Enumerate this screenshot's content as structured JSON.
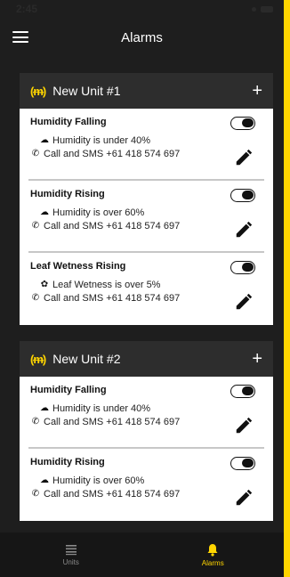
{
  "status": {
    "time": "2:45"
  },
  "nav": {
    "title": "Alarms"
  },
  "units": [
    {
      "name": "New Unit #1",
      "alarms": [
        {
          "title": "Humidity Falling",
          "condition_icon": "cloud-icon",
          "condition": "Humidity is under 40%",
          "action": "Call and SMS +61 418 574 697",
          "enabled": false
        },
        {
          "title": "Humidity Rising",
          "condition_icon": "cloud-icon",
          "condition": "Humidity is over 60%",
          "action": "Call and SMS +61 418 574 697",
          "enabled": false
        },
        {
          "title": "Leaf Wetness Rising",
          "condition_icon": "leaf-icon",
          "condition": "Leaf Wetness is over 5%",
          "action": "Call and SMS +61 418 574 697",
          "enabled": false
        }
      ]
    },
    {
      "name": "New Unit #2",
      "alarms": [
        {
          "title": "Humidity Falling",
          "condition_icon": "cloud-icon",
          "condition": "Humidity is under 40%",
          "action": "Call and SMS +61 418 574 697",
          "enabled": false
        },
        {
          "title": "Humidity Rising",
          "condition_icon": "cloud-icon",
          "condition": "Humidity is over 60%",
          "action": "Call and SMS +61 418 574 697",
          "enabled": false
        }
      ]
    }
  ],
  "tabs": [
    {
      "label": "Units",
      "icon": "list-icon",
      "active": false
    },
    {
      "label": "Alarms",
      "icon": "bell-icon",
      "active": true
    }
  ],
  "colors": {
    "accent": "#FFD500",
    "background": "#1E1E1E",
    "card": "#FFFFFF"
  }
}
